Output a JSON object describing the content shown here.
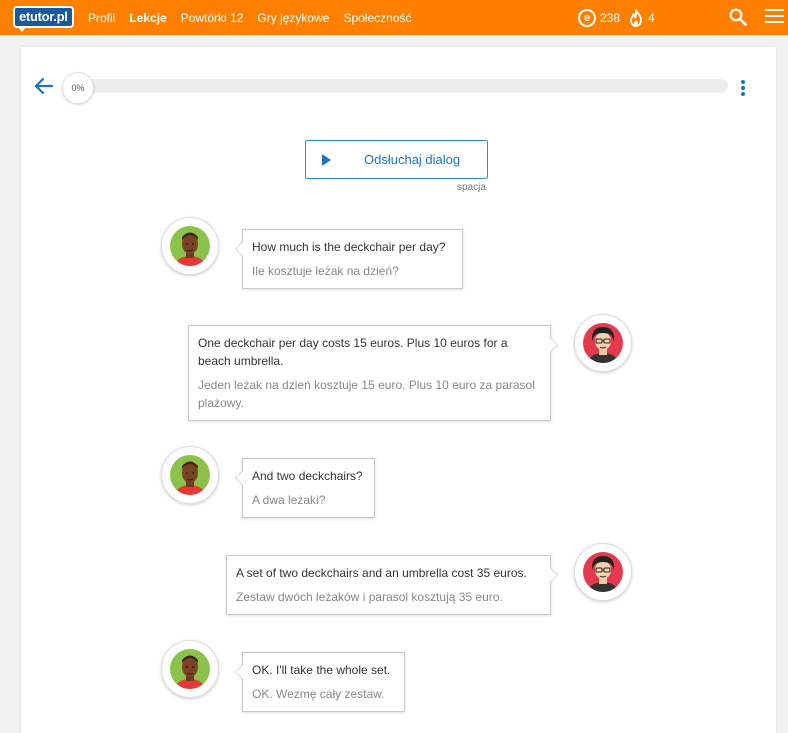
{
  "brand": {
    "logo_text": "etutor.pl",
    "accent": "#ff7f00",
    "link_color": "#1a73c2"
  },
  "nav": {
    "items": [
      {
        "label": "Profil",
        "active": false
      },
      {
        "label": "Lekcje",
        "active": true
      },
      {
        "label": "Powtórki 12",
        "active": false
      },
      {
        "label": "Gry językowe",
        "active": false
      },
      {
        "label": "Społeczność",
        "active": false
      }
    ]
  },
  "stats": {
    "coin_symbol": "e",
    "points": "238",
    "streak": "4"
  },
  "icons": {
    "search": "search-icon",
    "menu": "hamburger-menu-icon",
    "back": "arrow-left-icon",
    "more": "kebab-menu-icon",
    "play": "play-icon",
    "coin": "coin-icon",
    "streak": "flame-icon"
  },
  "lesson": {
    "progress_label": "0%",
    "progress_value": 0,
    "listen_button": "Odsłuchaj dialog",
    "listen_shortcut": "spacja"
  },
  "dialog": [
    {
      "speaker": "A",
      "side": "left",
      "en": "How much is the deckchair per day?",
      "pl": "Ile kosztuje leżak na dzień?"
    },
    {
      "speaker": "B",
      "side": "right",
      "en": "One deckchair per day costs 15 euros. Plus 10 euros for a beach umbrella.",
      "pl": "Jeden leżak na dzień kosztuje 15 euro. Plus 10 euro za parasol plażowy."
    },
    {
      "speaker": "A",
      "side": "left",
      "en": "And two deckchairs?",
      "pl": "A dwa leżaki?"
    },
    {
      "speaker": "B",
      "side": "right",
      "en": "A set of two deckchairs and an umbrella cost 35 euros.",
      "pl": "Zestaw dwóch leżaków i parasol kosztują 35 euro."
    },
    {
      "speaker": "A",
      "side": "left",
      "en": "OK. I'll take the whole set.",
      "pl": "OK. Wezmę cały zestaw."
    }
  ]
}
